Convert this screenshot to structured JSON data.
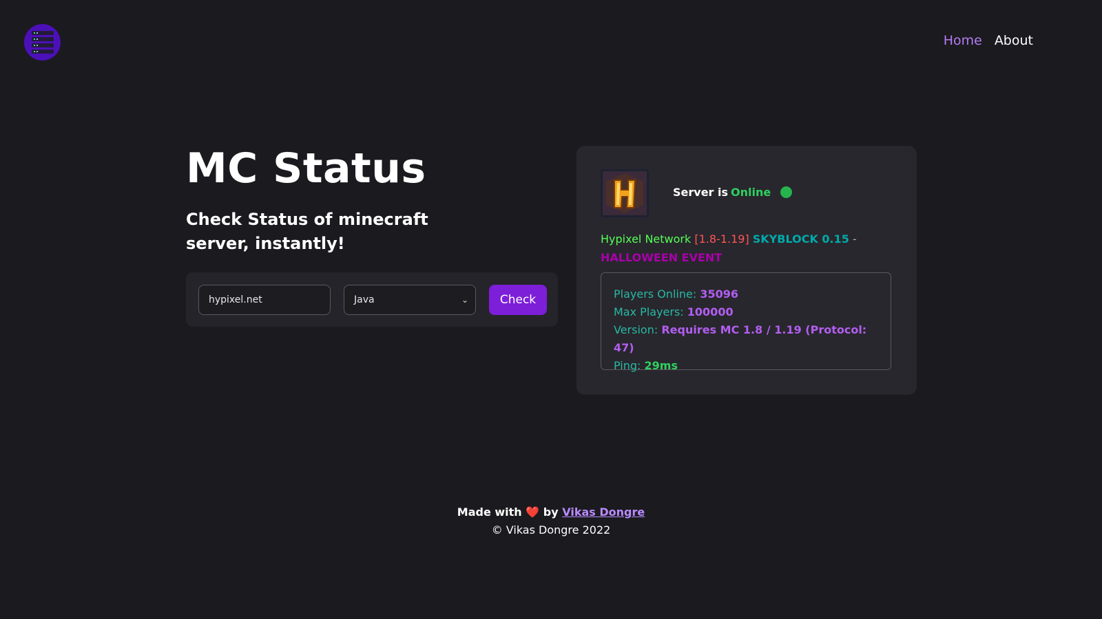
{
  "nav": {
    "logo": "server-stack-icon",
    "links": [
      {
        "label": "Home",
        "active": true
      },
      {
        "label": "About",
        "active": false
      }
    ]
  },
  "hero": {
    "title": "MC Status",
    "subtitle": "Check Status of minecraft server, instantly!"
  },
  "form": {
    "address_value": "hypixel.net",
    "edition_value": "Java",
    "button_label": "Check"
  },
  "result": {
    "status_prefix": "Server is",
    "status_value": "Online",
    "status_color": "#27b34e",
    "motd": {
      "name": "Hypixel Network",
      "versions": "[1.8-1.19]",
      "skyblock": "SKYBLOCK 0.15",
      "dash": "-",
      "event": "HALLOWEEN EVENT"
    },
    "players_online_label": "Players Online:",
    "players_online_value": "35096",
    "max_players_label": "Max Players:",
    "max_players_value": "100000",
    "version_label": "Version:",
    "version_value": "Requires MC 1.8 / 1.19 (Protocol: 47)",
    "ping_label": "Ping:",
    "ping_value": "29ms"
  },
  "footer": {
    "made_prefix": "Made with",
    "heart": "❤️",
    "made_by": "by",
    "author": "Vikas Dongre",
    "copyright": "© Vikas Dongre 2022"
  },
  "colors": {
    "accent": "#7d1ed9",
    "background": "#1b1a1f",
    "card": "#28272d"
  }
}
